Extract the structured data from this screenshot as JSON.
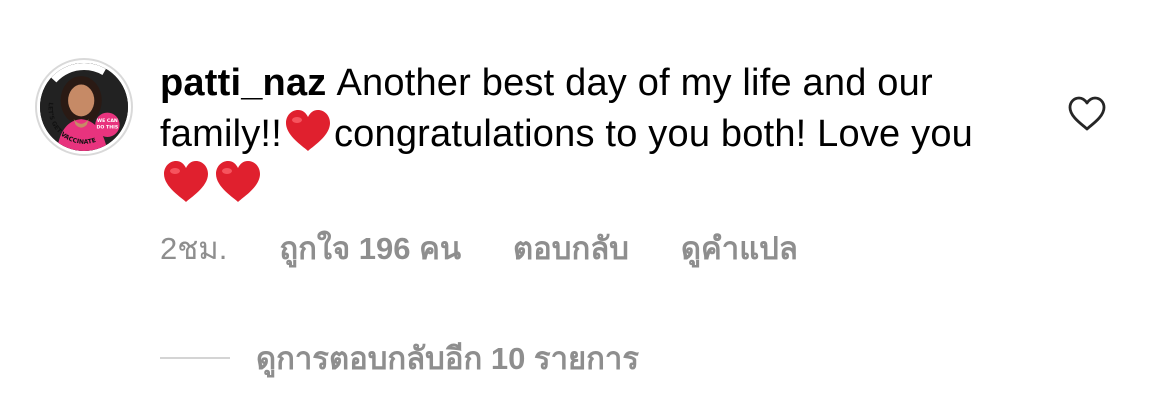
{
  "comment": {
    "username": "patti_naz",
    "text_part1": "Another best day of my life and our family!!",
    "text_part2": "congratulations to you both! Love you",
    "emoji": "red-heart"
  },
  "meta": {
    "time": "2ชม.",
    "likes": "ถูกใจ 196 คน",
    "reply": "ตอบกลับ",
    "translate": "ดูคำแปล"
  },
  "replies": {
    "label": "ดูการตอบกลับอีก 10 รายการ"
  },
  "avatar": {
    "badge_text": "LET'S GET VACCINATED",
    "sticker_text": "WE CAN DO THIS"
  },
  "colors": {
    "heart_red": "#e0202e",
    "meta_gray": "#8e8e8e",
    "sticker_pink": "#e8337e"
  }
}
